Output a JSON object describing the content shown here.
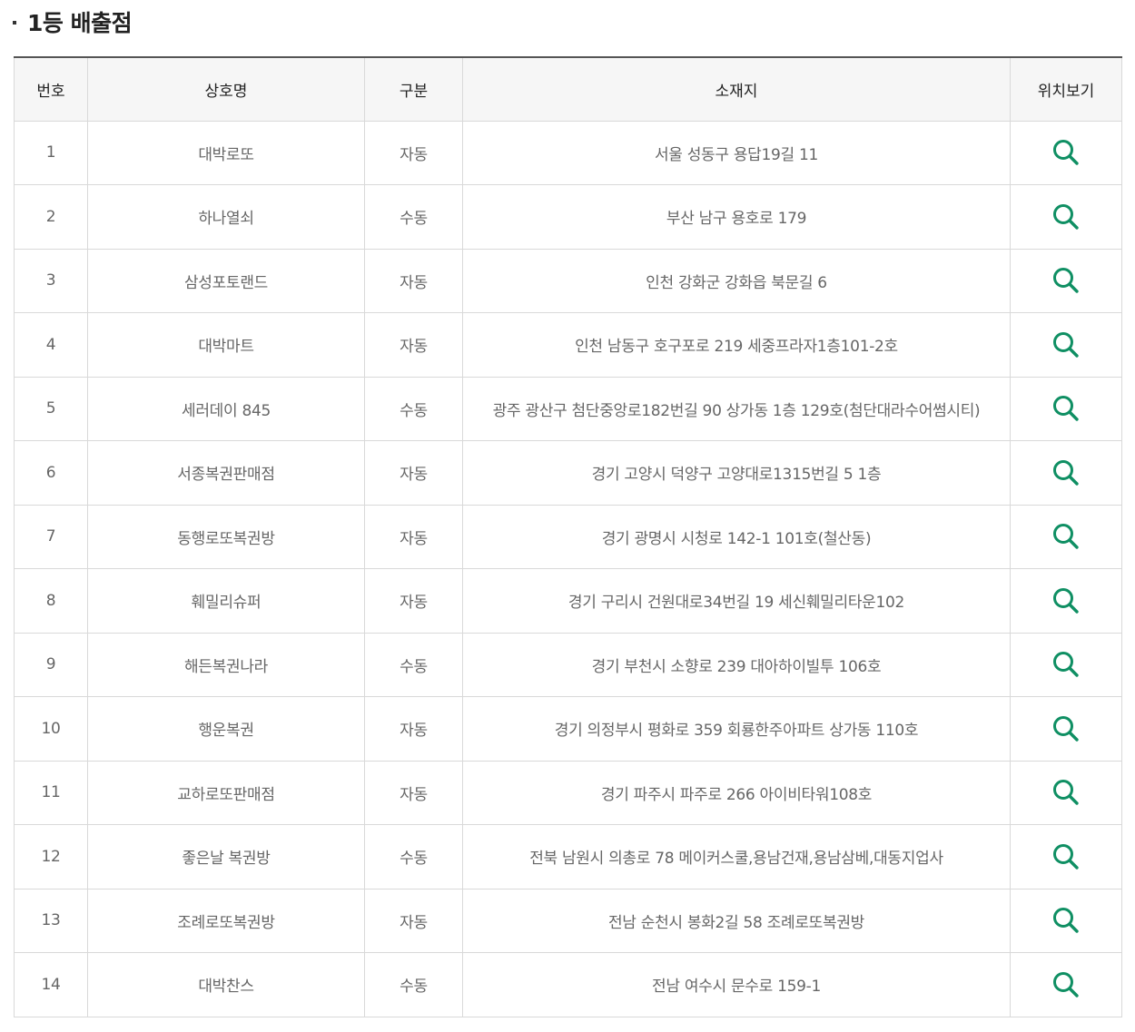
{
  "section": {
    "title": "1등 배출점"
  },
  "table": {
    "headers": {
      "no": "번호",
      "name": "상호명",
      "type": "구분",
      "address": "소재지",
      "map": "위치보기"
    },
    "rows": [
      {
        "no": "1",
        "name": "대박로또",
        "type": "자동",
        "address": "서울 성동구 용답19길 11"
      },
      {
        "no": "2",
        "name": "하나열쇠",
        "type": "수동",
        "address": "부산 남구 용호로 179"
      },
      {
        "no": "3",
        "name": "삼성포토랜드",
        "type": "자동",
        "address": "인천 강화군 강화읍 북문길 6"
      },
      {
        "no": "4",
        "name": "대박마트",
        "type": "자동",
        "address": "인천 남동구 호구포로 219 세중프라자1층101-2호"
      },
      {
        "no": "5",
        "name": "세러데이 845",
        "type": "수동",
        "address": "광주 광산구 첨단중앙로182번길 90 상가동 1층 129호(첨단대라수어썸시티)"
      },
      {
        "no": "6",
        "name": "서종복권판매점",
        "type": "자동",
        "address": "경기 고양시 덕양구 고양대로1315번길 5 1층"
      },
      {
        "no": "7",
        "name": "동행로또복권방",
        "type": "자동",
        "address": "경기 광명시 시청로 142-1 101호(철산동)"
      },
      {
        "no": "8",
        "name": "훼밀리슈퍼",
        "type": "자동",
        "address": "경기 구리시 건원대로34번길 19 세신훼밀리타운102"
      },
      {
        "no": "9",
        "name": "해든복권나라",
        "type": "수동",
        "address": "경기 부천시 소향로 239 대아하이빌투 106호"
      },
      {
        "no": "10",
        "name": "행운복권",
        "type": "자동",
        "address": "경기 의정부시 평화로 359 회룡한주아파트 상가동 110호"
      },
      {
        "no": "11",
        "name": "교하로또판매점",
        "type": "자동",
        "address": "경기 파주시 파주로 266 아이비타워108호"
      },
      {
        "no": "12",
        "name": "좋은날 복권방",
        "type": "수동",
        "address": "전북 남원시 의총로 78 메이커스쿨,용남건재,용남삼베,대동지업사"
      },
      {
        "no": "13",
        "name": "조례로또복권방",
        "type": "자동",
        "address": "전남 순천시 봉화2길 58 조례로또복권방"
      },
      {
        "no": "14",
        "name": "대박찬스",
        "type": "수동",
        "address": "전남 여수시 문수로 159-1"
      }
    ]
  },
  "icons": {
    "map": "search-icon",
    "color": "#0f8f63"
  }
}
